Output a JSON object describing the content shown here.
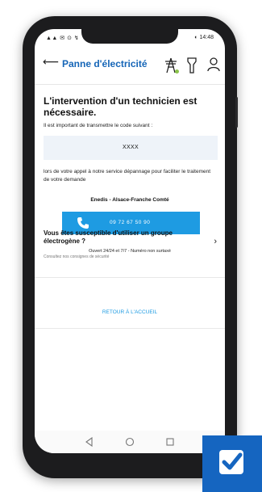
{
  "status": {
    "left": "▲▲ ✉ ⊙ ↯",
    "time": "14:48",
    "battery": "◐"
  },
  "app_bar": {
    "title": "Panne d'électricité"
  },
  "main": {
    "heading": "L'intervention d'un technicien est nécessaire.",
    "intro": "Il est important de transmettre le code suivant :",
    "code": "XXXX",
    "description": "lors de votre appel à notre service dépannage pour faciliter le traitement de votre demande",
    "operator": "Enedis - Alsace-Franche Comté",
    "phone": "09 72 67 50 90",
    "hours": "Ouvert 24/24 et 7/7 - Numéro non surtaxé"
  },
  "generator": {
    "title": "Vous êtes susceptible d'utiliser un groupe électrogène ?",
    "subtitle": "Consultez nos consignes de sécurité"
  },
  "return_link": "RETOUR À L'ACCUEIL",
  "colors": {
    "primary": "#1565b7",
    "accent": "#1e9be2",
    "badge": "#1565c0"
  }
}
